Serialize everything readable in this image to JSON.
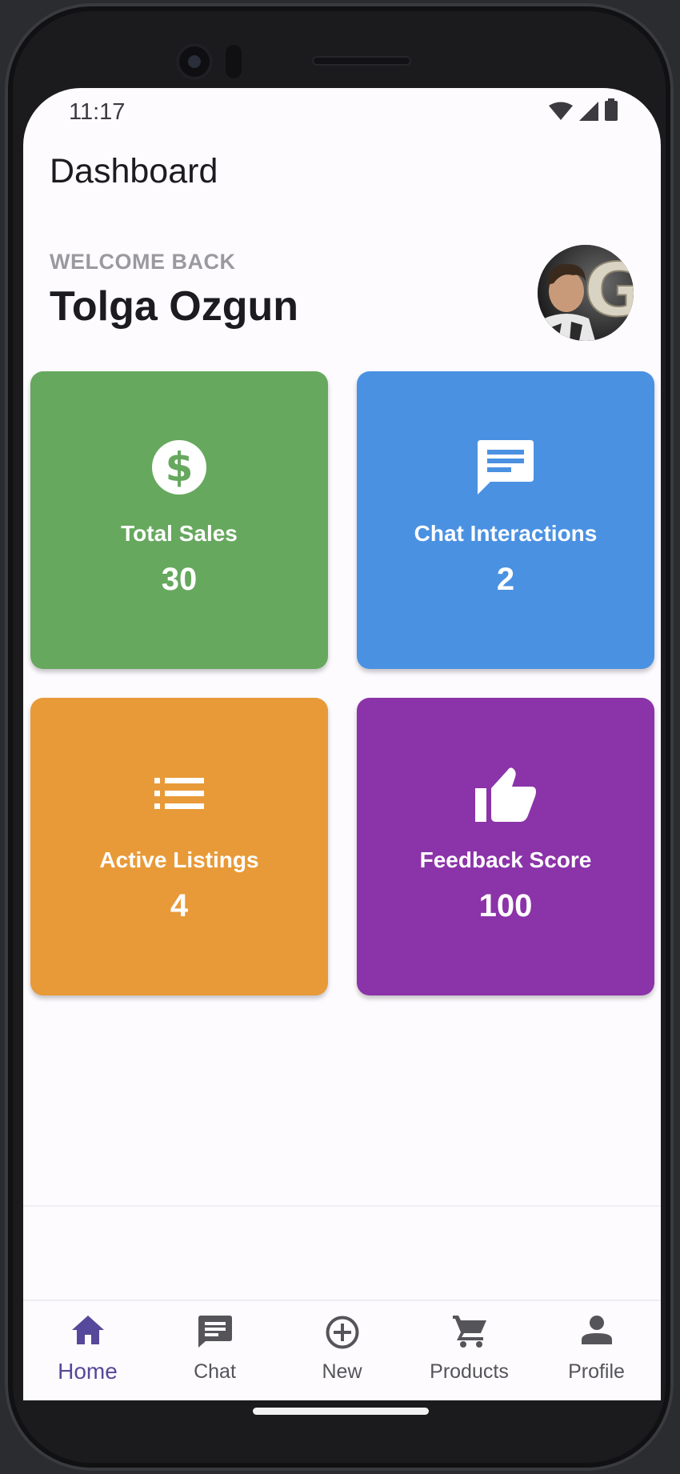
{
  "status_bar": {
    "time": "11:17"
  },
  "app_bar": {
    "title": "Dashboard"
  },
  "greeting": {
    "label": "WELCOME BACK",
    "name": "Tolga Ozgun"
  },
  "colors": {
    "green": "#66a85e",
    "blue": "#4a91e2",
    "orange": "#e89a38",
    "purple": "#8b33a8",
    "accent": "#56489a"
  },
  "stats": [
    {
      "label": "Total Sales",
      "value": "30",
      "icon": "dollar-icon"
    },
    {
      "label": "Chat Interactions",
      "value": "2",
      "icon": "chat-icon"
    },
    {
      "label": "Active Listings",
      "value": "4",
      "icon": "list-icon"
    },
    {
      "label": "Feedback Score",
      "value": "100",
      "icon": "thumb-up-icon"
    }
  ],
  "nav": {
    "items": [
      {
        "label": "Home",
        "icon": "home-icon",
        "active": true
      },
      {
        "label": "Chat",
        "icon": "chat-icon",
        "active": false
      },
      {
        "label": "New",
        "icon": "add-circle-icon",
        "active": false
      },
      {
        "label": "Products",
        "icon": "cart-icon",
        "active": false
      },
      {
        "label": "Profile",
        "icon": "person-icon",
        "active": false
      }
    ]
  }
}
